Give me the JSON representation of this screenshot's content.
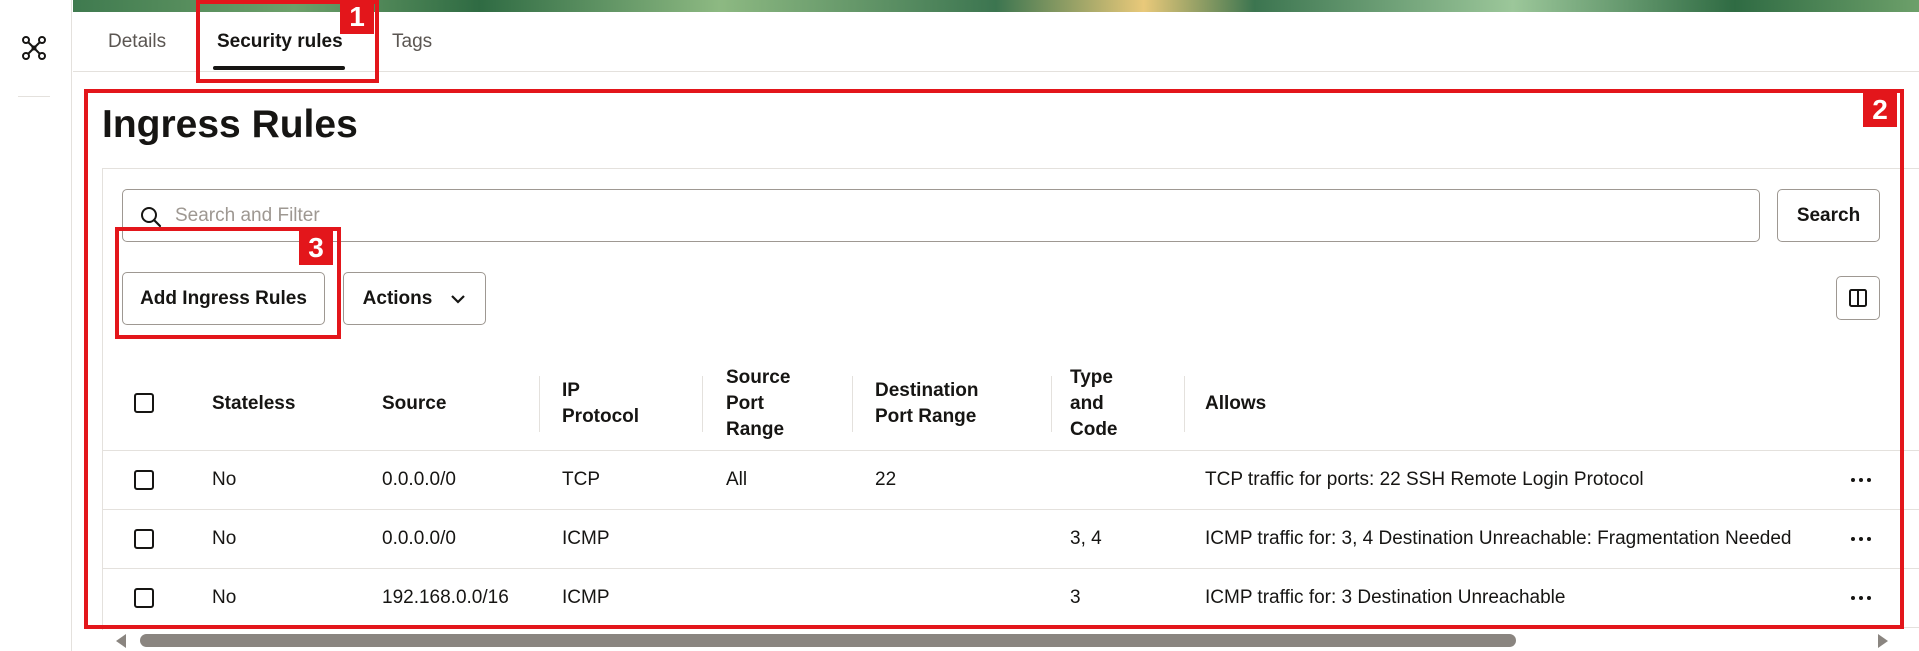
{
  "tabs": [
    {
      "label": "Details",
      "active": false
    },
    {
      "label": "Security rules",
      "active": true
    },
    {
      "label": "Tags",
      "active": false
    }
  ],
  "page_title": "Ingress Rules",
  "search": {
    "placeholder": "Search and Filter",
    "button_label": "Search"
  },
  "toolbar": {
    "add_label": "Add Ingress Rules",
    "actions_label": "Actions"
  },
  "table": {
    "headers": {
      "stateless": "Stateless",
      "source": "Source",
      "ip_protocol": [
        "IP",
        "Protocol"
      ],
      "source_port_range": [
        "Source",
        "Port",
        "Range"
      ],
      "destination_port_range": [
        "Destination",
        "Port Range"
      ],
      "type_and_code": [
        "Type",
        "and",
        "Code"
      ],
      "allows": "Allows"
    },
    "rows": [
      {
        "stateless": "No",
        "source": "0.0.0.0/0",
        "ip_protocol": "TCP",
        "source_port_range": "All",
        "destination_port_range": "22",
        "type_and_code": "",
        "allows": "TCP traffic for ports: 22 SSH Remote Login Protocol"
      },
      {
        "stateless": "No",
        "source": "0.0.0.0/0",
        "ip_protocol": "ICMP",
        "source_port_range": "",
        "destination_port_range": "",
        "type_and_code": "3, 4",
        "allows": "ICMP traffic for: 3, 4 Destination Unreachable: Fragmentation Needed"
      },
      {
        "stateless": "No",
        "source": "192.168.0.0/16",
        "ip_protocol": "ICMP",
        "source_port_range": "",
        "destination_port_range": "",
        "type_and_code": "3",
        "allows": "ICMP traffic for: 3 Destination Unreachable"
      }
    ]
  },
  "annotations": [
    "1",
    "2",
    "3"
  ],
  "icons": {
    "rail": "network-icon",
    "search": "search-icon",
    "actions": "chevron-down-icon",
    "columns": "columns-icon",
    "row_menu": "more-horizontal-icon"
  },
  "colors": {
    "annotation": "#e3161b",
    "text": "#161513",
    "border": "#9e9892"
  }
}
